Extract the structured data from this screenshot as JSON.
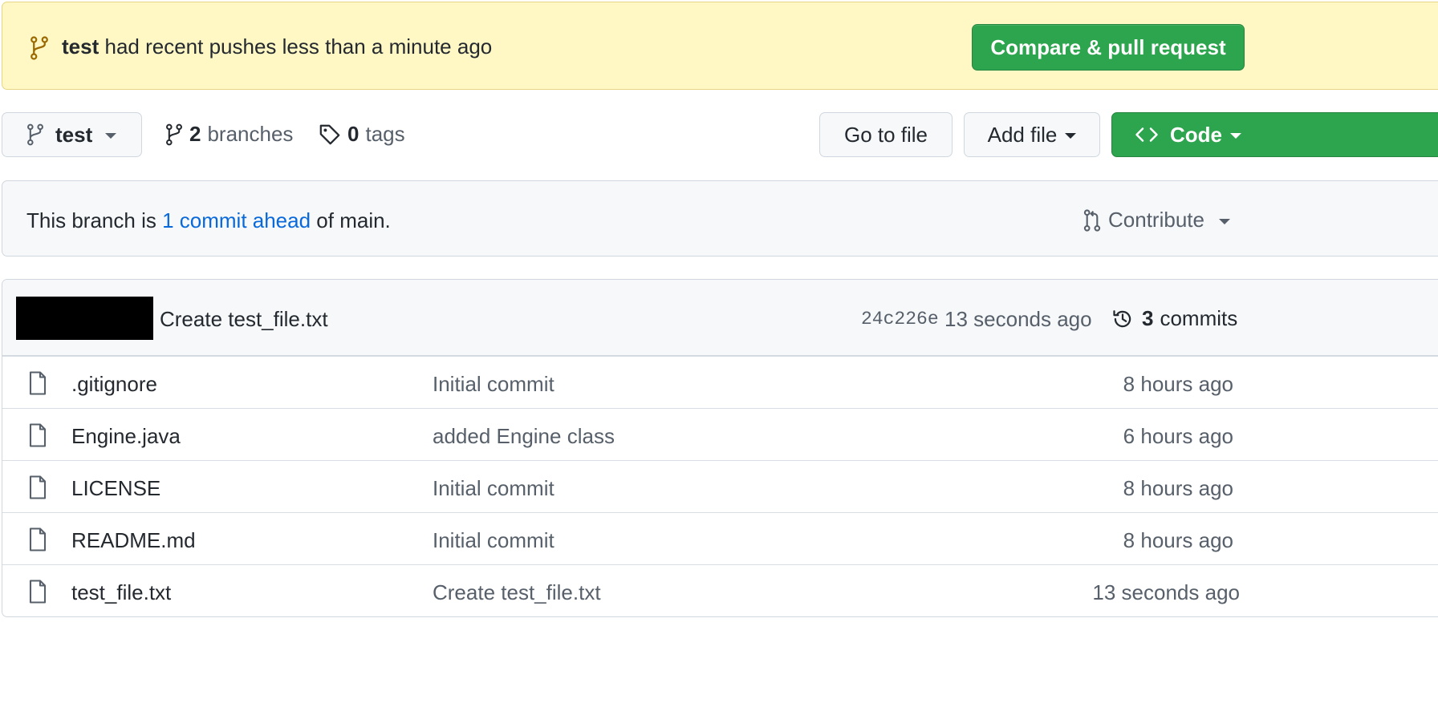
{
  "banner": {
    "branch": "test",
    "message": "had recent pushes less than a minute ago",
    "compare_button": "Compare & pull request"
  },
  "toolbar": {
    "branch_selector": "test",
    "branches_count": "2",
    "branches_label": "branches",
    "tags_count": "0",
    "tags_label": "tags",
    "go_to_file": "Go to file",
    "add_file": "Add file",
    "code": "Code"
  },
  "ahead": {
    "prefix": "This branch is",
    "link": "1 commit ahead",
    "suffix": "of main.",
    "contribute": "Contribute"
  },
  "latest_commit": {
    "message": "Create test_file.txt",
    "sha": "24c226e",
    "time": "13 seconds ago",
    "commits_count": "3",
    "commits_label": "commits"
  },
  "files": [
    {
      "name": ".gitignore",
      "message": "Initial commit",
      "time": "8 hours ago"
    },
    {
      "name": "Engine.java",
      "message": "added Engine class",
      "time": "6 hours ago"
    },
    {
      "name": "LICENSE",
      "message": "Initial commit",
      "time": "8 hours ago"
    },
    {
      "name": "README.md",
      "message": "Initial commit",
      "time": "8 hours ago"
    },
    {
      "name": "test_file.txt",
      "message": "Create test_file.txt",
      "time": "13 seconds ago"
    }
  ],
  "colors": {
    "banner_bg": "#fff8c5",
    "primary_green": "#2da44e",
    "link_blue": "#0969da",
    "muted_text": "#57606a"
  }
}
